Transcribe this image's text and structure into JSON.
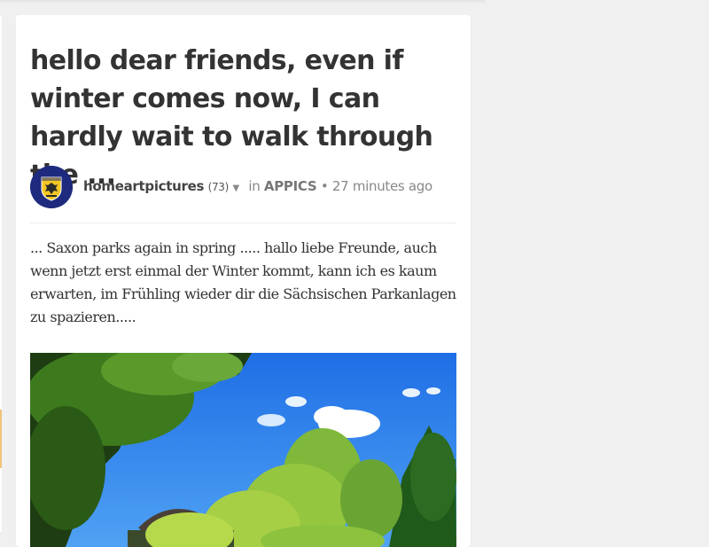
{
  "post": {
    "title": "hello dear friends, even if winter comes now, I can hardly wait to walk through the ...",
    "author": "homeartpictures",
    "reputation": "(73)",
    "in_label": "in",
    "community": "APPICS",
    "separator": "•",
    "time": "27 minutes ago",
    "body": "... Saxon parks again in spring ..... hallo liebe Freunde, auch wenn jetzt erst einmal der Winter kommt, kann ich es kaum erwarten, im Frühling wieder dir die Sächsischen Parkanlagen zu spazieren.....",
    "avatar_icon": "coat-of-arms-icon",
    "caret_icon": "caret-down-icon",
    "image_name": "park-photo"
  },
  "colors": {
    "page_background": "#f0f0f0",
    "card_background": "#ffffff",
    "title": "#333333",
    "meta": "#888888",
    "avatar_background": "#1d2a7e",
    "side_accent": "#f2c27a"
  }
}
